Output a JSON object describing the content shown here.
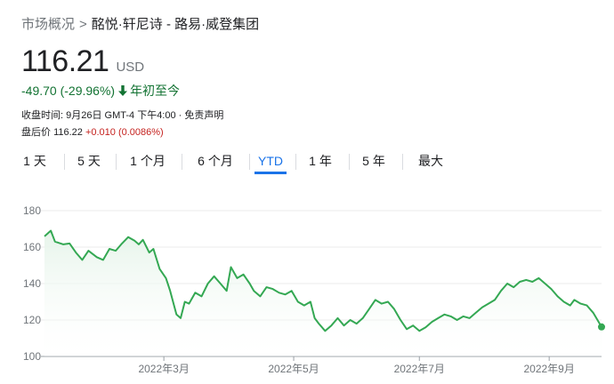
{
  "breadcrumb": {
    "root": "市场概况",
    "separator": ">",
    "current": "酩悦·轩尼诗 - 路易·威登集团"
  },
  "quote": {
    "price": "116.21",
    "currency": "USD",
    "change": "-49.70 (-29.96%)",
    "period": "年初至今",
    "close_info": "收盘时间: 9月26日 GMT-4 下午4:00 · 免责声明",
    "after_hours_label": "盘后价",
    "after_hours_price": "116.22",
    "after_hours_change": "+0.010 (0.0086%)"
  },
  "tabs": [
    {
      "label": "1 天",
      "active": false
    },
    {
      "label": "5 天",
      "active": false
    },
    {
      "label": "1 个月",
      "active": false
    },
    {
      "label": "6 个月",
      "active": false
    },
    {
      "label": "YTD",
      "active": true
    },
    {
      "label": "1 年",
      "active": false
    },
    {
      "label": "5 年",
      "active": false
    },
    {
      "label": "最大",
      "active": false
    }
  ],
  "colors": {
    "line": "#34a853",
    "fill_top": "#e6f4ea",
    "negative": "#137333",
    "accent": "#1a73e8",
    "after_hours": "#c5221f"
  },
  "chart_data": {
    "type": "area",
    "title": "",
    "xlabel": "",
    "ylabel": "",
    "ylim": [
      100,
      180
    ],
    "yticks": [
      100,
      120,
      140,
      160,
      180
    ],
    "grid": true,
    "xticks": [
      {
        "label": "2022年3月",
        "date": "2022-03-01"
      },
      {
        "label": "2022年5月",
        "date": "2022-05-02"
      },
      {
        "label": "2022年7月",
        "date": "2022-07-01"
      },
      {
        "label": "2022年9月",
        "date": "2022-09-01"
      }
    ],
    "xrange": [
      "2022-01-03",
      "2022-09-26"
    ],
    "series": [
      {
        "values": [
          [
            "2022-01-03",
            165.9
          ],
          [
            "2022-01-06",
            169.0
          ],
          [
            "2022-01-08",
            163.0
          ],
          [
            "2022-01-12",
            161.5
          ],
          [
            "2022-01-15",
            162.0
          ],
          [
            "2022-01-18",
            157.0
          ],
          [
            "2022-01-21",
            153.0
          ],
          [
            "2022-01-24",
            158.0
          ],
          [
            "2022-01-28",
            154.5
          ],
          [
            "2022-01-31",
            153.0
          ],
          [
            "2022-02-03",
            159.0
          ],
          [
            "2022-02-06",
            158.0
          ],
          [
            "2022-02-09",
            162.0
          ],
          [
            "2022-02-12",
            165.5
          ],
          [
            "2022-02-15",
            163.5
          ],
          [
            "2022-02-17",
            161.5
          ],
          [
            "2022-02-19",
            164.0
          ],
          [
            "2022-02-22",
            157.0
          ],
          [
            "2022-02-24",
            159.0
          ],
          [
            "2022-02-27",
            148.0
          ],
          [
            "2022-03-02",
            143.0
          ],
          [
            "2022-03-04",
            136.0
          ],
          [
            "2022-03-07",
            123.0
          ],
          [
            "2022-03-09",
            121.0
          ],
          [
            "2022-03-11",
            130.0
          ],
          [
            "2022-03-13",
            129.0
          ],
          [
            "2022-03-16",
            135.0
          ],
          [
            "2022-03-19",
            133.0
          ],
          [
            "2022-03-22",
            140.0
          ],
          [
            "2022-03-25",
            144.0
          ],
          [
            "2022-03-28",
            140.0
          ],
          [
            "2022-03-31",
            136.0
          ],
          [
            "2022-04-02",
            149.0
          ],
          [
            "2022-04-05",
            143.0
          ],
          [
            "2022-04-08",
            145.0
          ],
          [
            "2022-04-11",
            140.0
          ],
          [
            "2022-04-13",
            136.0
          ],
          [
            "2022-04-16",
            133.0
          ],
          [
            "2022-04-19",
            138.0
          ],
          [
            "2022-04-22",
            137.0
          ],
          [
            "2022-04-25",
            135.0
          ],
          [
            "2022-04-28",
            134.0
          ],
          [
            "2022-05-01",
            136.0
          ],
          [
            "2022-05-04",
            130.0
          ],
          [
            "2022-05-07",
            128.0
          ],
          [
            "2022-05-10",
            130.0
          ],
          [
            "2022-05-12",
            121.0
          ],
          [
            "2022-05-14",
            118.0
          ],
          [
            "2022-05-17",
            114.0
          ],
          [
            "2022-05-20",
            117.0
          ],
          [
            "2022-05-23",
            121.0
          ],
          [
            "2022-05-26",
            117.0
          ],
          [
            "2022-05-29",
            120.0
          ],
          [
            "2022-06-01",
            118.0
          ],
          [
            "2022-06-04",
            121.0
          ],
          [
            "2022-06-07",
            126.0
          ],
          [
            "2022-06-10",
            131.0
          ],
          [
            "2022-06-13",
            129.0
          ],
          [
            "2022-06-16",
            130.0
          ],
          [
            "2022-06-19",
            126.0
          ],
          [
            "2022-06-22",
            120.0
          ],
          [
            "2022-06-25",
            115.0
          ],
          [
            "2022-06-28",
            117.0
          ],
          [
            "2022-07-01",
            114.0
          ],
          [
            "2022-07-04",
            116.0
          ],
          [
            "2022-07-07",
            119.0
          ],
          [
            "2022-07-10",
            121.0
          ],
          [
            "2022-07-13",
            123.0
          ],
          [
            "2022-07-16",
            122.0
          ],
          [
            "2022-07-19",
            120.0
          ],
          [
            "2022-07-22",
            122.0
          ],
          [
            "2022-07-25",
            121.0
          ],
          [
            "2022-07-28",
            124.0
          ],
          [
            "2022-07-31",
            127.0
          ],
          [
            "2022-08-03",
            129.0
          ],
          [
            "2022-08-06",
            131.0
          ],
          [
            "2022-08-09",
            136.0
          ],
          [
            "2022-08-12",
            140.0
          ],
          [
            "2022-08-15",
            138.0
          ],
          [
            "2022-08-18",
            141.0
          ],
          [
            "2022-08-21",
            142.0
          ],
          [
            "2022-08-24",
            141.0
          ],
          [
            "2022-08-27",
            143.0
          ],
          [
            "2022-08-30",
            140.0
          ],
          [
            "2022-09-02",
            137.0
          ],
          [
            "2022-09-05",
            133.0
          ],
          [
            "2022-09-08",
            130.0
          ],
          [
            "2022-09-11",
            128.0
          ],
          [
            "2022-09-13",
            131.0
          ],
          [
            "2022-09-16",
            129.0
          ],
          [
            "2022-09-19",
            128.0
          ],
          [
            "2022-09-22",
            124.0
          ],
          [
            "2022-09-26",
            116.21
          ]
        ]
      }
    ]
  }
}
